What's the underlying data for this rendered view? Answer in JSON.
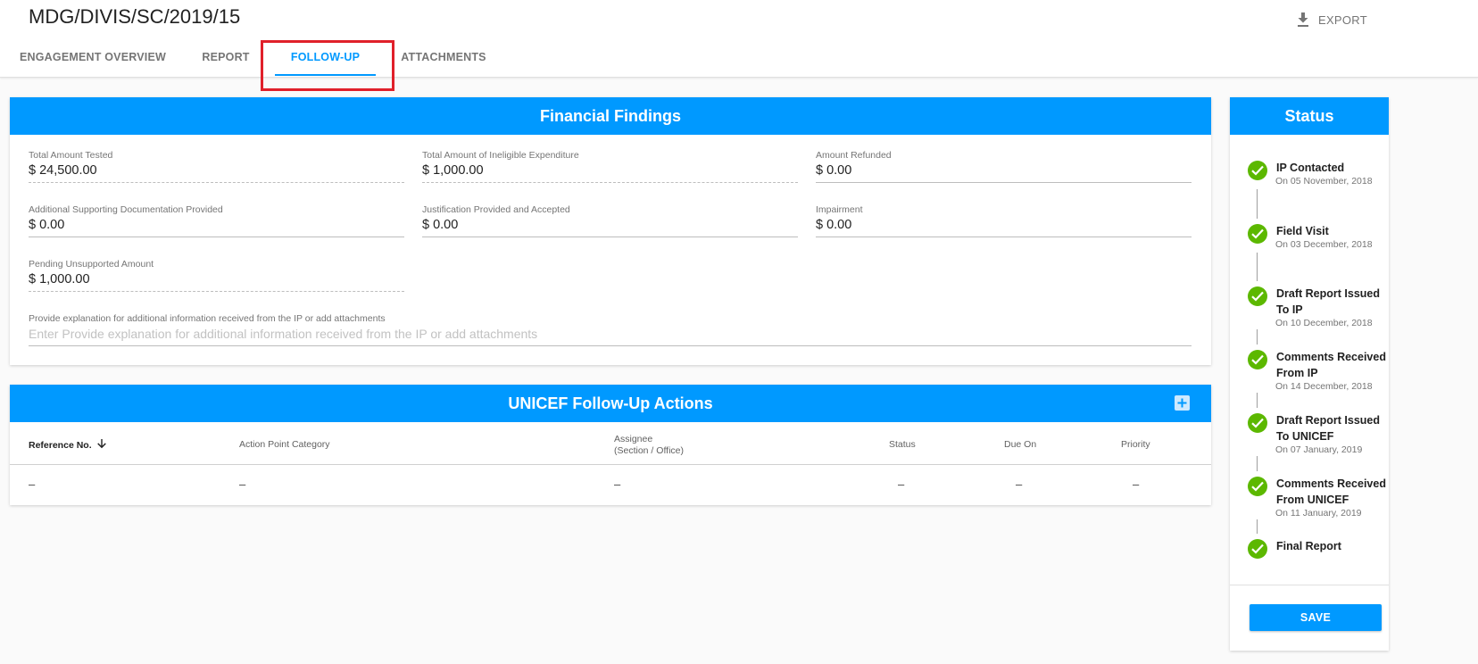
{
  "header": {
    "title": "MDG/DIVIS/SC/2019/15",
    "export_label": "EXPORT",
    "tabs": [
      {
        "label": "ENGAGEMENT OVERVIEW"
      },
      {
        "label": "REPORT"
      },
      {
        "label": "FOLLOW-UP",
        "active": true
      },
      {
        "label": "ATTACHMENTS"
      }
    ]
  },
  "financial_findings": {
    "title": "Financial Findings",
    "fields": [
      {
        "label": "Total Amount Tested",
        "value": "$ 24,500.00"
      },
      {
        "label": "Total Amount of Ineligible Expenditure",
        "value": "$ 1,000.00"
      },
      {
        "label": "Amount Refunded",
        "value": "$ 0.00"
      },
      {
        "label": "Additional Supporting Documentation Provided",
        "value": "$ 0.00"
      },
      {
        "label": "Justification Provided and Accepted",
        "value": "$ 0.00"
      },
      {
        "label": "Impairment",
        "value": "$ 0.00"
      },
      {
        "label": "Pending Unsupported Amount",
        "value": "$ 1,000.00"
      }
    ],
    "explanation": {
      "label": "Provide explanation for additional information received from the IP or add attachments",
      "placeholder": "Enter Provide explanation for additional information received from the IP or add attachments"
    }
  },
  "follow_up_actions": {
    "title": "UNICEF Follow-Up Actions",
    "columns": [
      {
        "label": "Reference No."
      },
      {
        "label": "Action Point Category"
      },
      {
        "label": "Assignee",
        "sub": "(Section / Office)"
      },
      {
        "label": "Status"
      },
      {
        "label": "Due On"
      },
      {
        "label": "Priority"
      }
    ],
    "row": [
      "–",
      "–",
      "–",
      "–",
      "–",
      "–"
    ]
  },
  "status_panel": {
    "title": "Status",
    "steps": [
      {
        "title_lines": [
          "IP Contacted"
        ],
        "date": "On 05 November, 2018"
      },
      {
        "title_lines": [
          "Field Visit"
        ],
        "date": "On 03 December, 2018"
      },
      {
        "title_lines": [
          "Draft Report Issued",
          "To IP"
        ],
        "date": "On 10 December, 2018"
      },
      {
        "title_lines": [
          "Comments Received",
          "From IP"
        ],
        "date": "On 14 December, 2018"
      },
      {
        "title_lines": [
          "Draft Report Issued",
          "To UNICEF"
        ],
        "date": "On 07 January, 2019"
      },
      {
        "title_lines": [
          "Comments Received",
          "From UNICEF"
        ],
        "date": "On 11 January, 2019"
      },
      {
        "title_lines": [
          "Final Report"
        ],
        "date": ""
      }
    ],
    "save_label": "SAVE"
  },
  "colors": {
    "accent": "#0099ff",
    "success": "#5cb800",
    "highlight": "#e0202a"
  }
}
